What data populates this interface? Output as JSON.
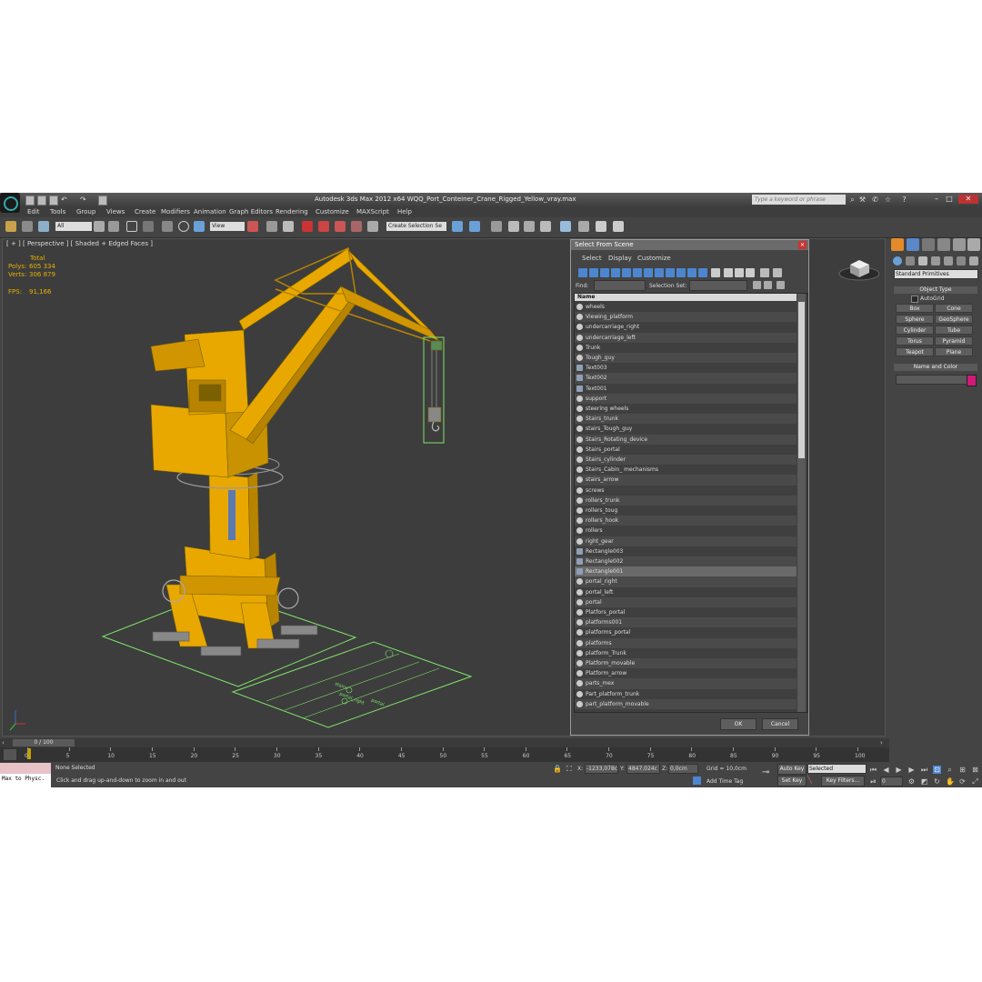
{
  "window": {
    "title": "Autodesk 3ds Max  2012 x64      WQQ_Port_Conteiner_Crane_Rigged_Yellow_vray.max",
    "search_placeholder": "Type a keyword or phrase"
  },
  "menu": [
    "Edit",
    "Tools",
    "Group",
    "Views",
    "Create",
    "Modifiers",
    "Animation",
    "Graph Editors",
    "Rendering",
    "Customize",
    "MAXScript",
    "Help"
  ],
  "toolbar": {
    "selection_filter": "All",
    "ref_coord": "View",
    "named_selection": "Create Selection Se"
  },
  "viewport": {
    "label": "[ + ] [ Perspective ] [ Shaded + Edged Faces ]",
    "stats": {
      "total_label": "Total",
      "polys_label": "Polys:",
      "polys_value": "605 334",
      "verts_label": "Verts:",
      "verts_value": "306 879",
      "fps_label": "FPS:",
      "fps_value": "91,166"
    },
    "annotations": [
      "stairs",
      "portal_right",
      "portal"
    ]
  },
  "dialog": {
    "title": "Select From Scene",
    "menu": [
      "Select",
      "Display",
      "Customize"
    ],
    "find_label": "Find:",
    "selection_set_label": "Selection Set:",
    "column_header": "Name",
    "items": [
      {
        "name": "wheels",
        "type": "geo"
      },
      {
        "name": "Viewing_platform",
        "type": "geo"
      },
      {
        "name": "undercarriage_right",
        "type": "geo"
      },
      {
        "name": "undercarriage_left",
        "type": "geo"
      },
      {
        "name": "Trunk",
        "type": "geo"
      },
      {
        "name": "Tough_guy",
        "type": "geo"
      },
      {
        "name": "Text003",
        "type": "shape"
      },
      {
        "name": "Text002",
        "type": "shape"
      },
      {
        "name": "Text001",
        "type": "shape"
      },
      {
        "name": "support",
        "type": "geo"
      },
      {
        "name": "steering wheels",
        "type": "geo"
      },
      {
        "name": "Stairs_trunk",
        "type": "geo"
      },
      {
        "name": "stairs_Tough_guy",
        "type": "geo"
      },
      {
        "name": "Stairs_Rotating_device",
        "type": "geo"
      },
      {
        "name": "Stairs_portal",
        "type": "geo"
      },
      {
        "name": "Stairs_cylinder",
        "type": "geo"
      },
      {
        "name": "Stairs_Cabin_ mechanisms",
        "type": "geo"
      },
      {
        "name": "stairs_arrow",
        "type": "geo"
      },
      {
        "name": "screws",
        "type": "geo"
      },
      {
        "name": "rollers_trunk",
        "type": "geo"
      },
      {
        "name": "rollers_toug",
        "type": "geo"
      },
      {
        "name": "rollers_hook",
        "type": "geo"
      },
      {
        "name": "rollers",
        "type": "geo"
      },
      {
        "name": "right_gear",
        "type": "geo"
      },
      {
        "name": "Rectangle003",
        "type": "shape"
      },
      {
        "name": "Rectangle002",
        "type": "shape"
      },
      {
        "name": "Rectangle001",
        "type": "shape"
      },
      {
        "name": "portal_right",
        "type": "geo"
      },
      {
        "name": "portal_left",
        "type": "geo"
      },
      {
        "name": "portal",
        "type": "geo"
      },
      {
        "name": "Platfors_portal",
        "type": "geo"
      },
      {
        "name": "platforms001",
        "type": "geo"
      },
      {
        "name": "platforms_portal",
        "type": "geo"
      },
      {
        "name": "platforms",
        "type": "geo"
      },
      {
        "name": "platform_Trunk",
        "type": "geo"
      },
      {
        "name": "Platform_movable",
        "type": "geo"
      },
      {
        "name": "Platform_arrow",
        "type": "geo"
      },
      {
        "name": "parts_mex",
        "type": "geo"
      },
      {
        "name": "Part_platform_trunk",
        "type": "geo"
      },
      {
        "name": "part_platform_movable",
        "type": "geo"
      }
    ],
    "highlighted_item": "Rectangle001",
    "ok_label": "OK",
    "cancel_label": "Cancel"
  },
  "command_panel": {
    "category": "Standard Primitives",
    "object_type_title": "Object Type",
    "autogrid_label": "AutoGrid",
    "buttons": [
      "Box",
      "Cone",
      "Sphere",
      "GeoSphere",
      "Cylinder",
      "Tube",
      "Torus",
      "Pyramid",
      "Teapot",
      "Plane"
    ],
    "name_color_title": "Name and Color",
    "object_color": "#d01a7a"
  },
  "timeline": {
    "frame_display": "0 / 100",
    "ticks": [
      "0",
      "5",
      "10",
      "15",
      "20",
      "25",
      "30",
      "35",
      "40",
      "45",
      "50",
      "55",
      "60",
      "65",
      "70",
      "75",
      "80",
      "85",
      "90",
      "95",
      "100"
    ]
  },
  "status": {
    "maxscript_label": "Max to Physc.",
    "selection_status": "None Selected",
    "prompt": "Click and drag up-and-down to zoom in and out",
    "x_label": "X:",
    "x_value": "-1233,078c",
    "y_label": "Y:",
    "y_value": "4847,024c",
    "z_label": "Z:",
    "z_value": "0,0cm",
    "grid": "Grid = 10,0cm",
    "add_time_tag": "Add Time Tag",
    "auto_key": "Auto Key",
    "set_key": "Set Key",
    "key_mode": "Selected",
    "key_filters": "Key Filters...",
    "current_frame": "0"
  },
  "colors": {
    "crane": "#e8a800",
    "wire_green": "#7fe36a",
    "dialog_highlight": "#6a6a6a"
  }
}
